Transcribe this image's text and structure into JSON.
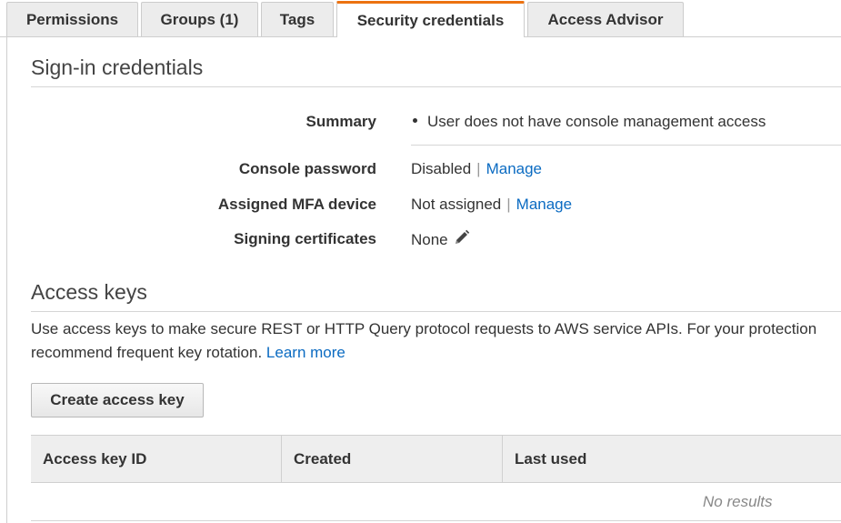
{
  "tabs": [
    {
      "label": "Permissions",
      "active": false
    },
    {
      "label": "Groups (1)",
      "active": false
    },
    {
      "label": "Tags",
      "active": false
    },
    {
      "label": "Security credentials",
      "active": true
    },
    {
      "label": "Access Advisor",
      "active": false
    }
  ],
  "signin": {
    "title": "Sign-in credentials",
    "summary_label": "Summary",
    "summary_text": "User does not have console management access",
    "console_password_label": "Console password",
    "console_password_value": "Disabled",
    "console_password_link": "Manage",
    "mfa_label": "Assigned MFA device",
    "mfa_value": "Not assigned",
    "mfa_link": "Manage",
    "signing_label": "Signing certificates",
    "signing_value": "None",
    "separator": "|"
  },
  "access_keys": {
    "title": "Access keys",
    "description_line1": "Use access keys to make secure REST or HTTP Query protocol requests to AWS service APIs. For your protection",
    "description_line2": "recommend frequent key rotation.",
    "learn_more": "Learn more",
    "create_button": "Create access key",
    "columns": [
      "Access key ID",
      "Created",
      "Last used"
    ],
    "empty_text": "No results"
  },
  "colors": {
    "accent_tab": "#ec7211",
    "link": "#0b6bc2"
  }
}
